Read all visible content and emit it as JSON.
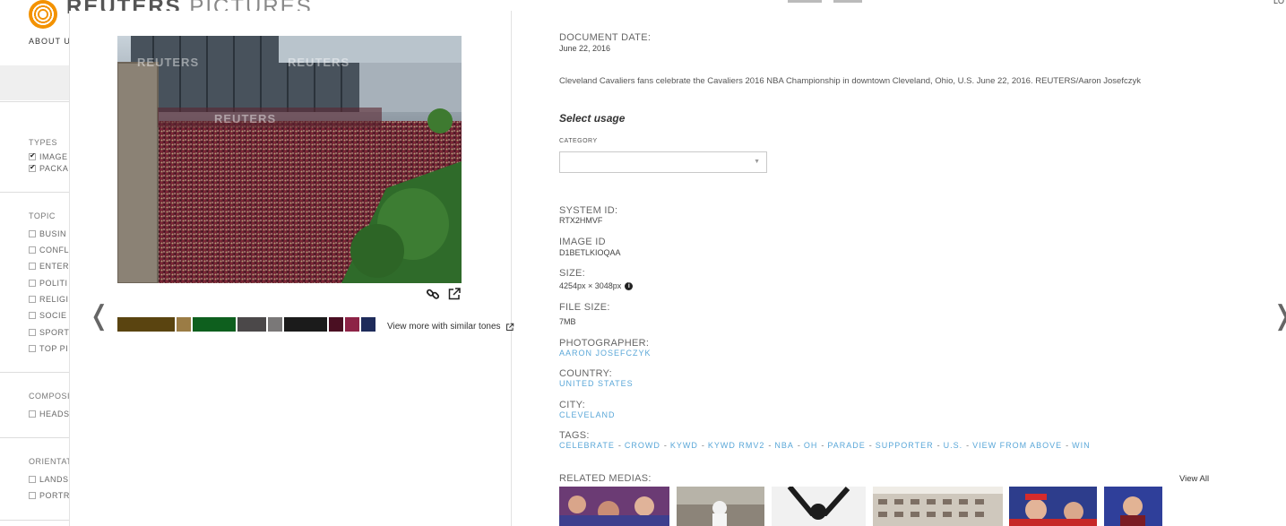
{
  "background": {
    "brand_name": "REUTERS",
    "brand_suffix": "PICTURES",
    "about_label": "ABOUT U",
    "login_label": "LO",
    "filters": {
      "types_heading": "TYPES",
      "types": [
        {
          "label": "IMAGE",
          "checked": true
        },
        {
          "label": "PACKA",
          "checked": true
        }
      ],
      "topic_heading": "TOPIC",
      "topics": [
        "BUSIN",
        "CONFL",
        "ENTER",
        "POLITI",
        "RELIGI",
        "SOCIE",
        "SPORT",
        "TOP PI"
      ],
      "composition_heading": "COMPOSI",
      "compositions": [
        "HEADS"
      ],
      "orientation_heading": "ORIENTAT",
      "orientations": [
        "LANDS",
        "PORTR"
      ]
    }
  },
  "photo": {
    "watermark": "REUTERS"
  },
  "tones": {
    "swatches": [
      "#5a4410",
      "#9b7c45",
      "#0e5f1e",
      "#4b4849",
      "#7a7878",
      "#1b1b1b",
      "#4a0f22",
      "#8d2346",
      "#1e2b5a"
    ],
    "similar_label": "View more with similar tones"
  },
  "details": {
    "document_date_label": "DOCUMENT DATE:",
    "document_date": "June 22, 2016",
    "caption": "Cleveland Cavaliers fans celebrate the Cavaliers 2016 NBA Championship in downtown Cleveland, Ohio, U.S. June 22, 2016. REUTERS/Aaron Josefczyk",
    "select_usage": "Select usage",
    "category_label": "CATEGORY",
    "category_value": "",
    "system_id_label": "SYSTEM ID:",
    "system_id": "RTX2HMVF",
    "image_id_label": "IMAGE ID",
    "image_id": "D1BETLKIOQAA",
    "size_label": "SIZE:",
    "size": "4254px × 3048px",
    "file_size_label": "FILE SIZE:",
    "file_size": "7MB",
    "photographer_label": "PHOTOGRAPHER:",
    "photographer": "AARON JOSEFCZYK",
    "country_label": "COUNTRY:",
    "country": "UNITED STATES",
    "city_label": "CITY:",
    "city": "CLEVELAND",
    "tags_label": "TAGS:",
    "tags": [
      "CELEBRATE",
      "CROWD",
      "KYWD",
      "KYWD RMV2",
      "NBA",
      "OH",
      "PARADE",
      "SUPPORTER",
      "U.S.",
      "VIEW FROM ABOVE",
      "WIN"
    ],
    "related_label": "RELATED MEDIAS:",
    "view_all": "View All"
  }
}
